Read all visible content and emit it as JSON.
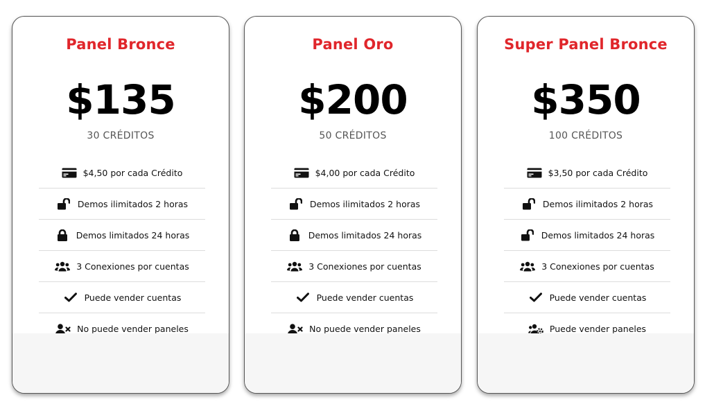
{
  "colors": {
    "title": "#e0262b",
    "price": "#000000",
    "footer": "#f6f6f6"
  },
  "plans": [
    {
      "title": "Panel Bronce",
      "price": "$135",
      "credits": "30 CRÉDITOS",
      "features": [
        {
          "icon": "credit-card-icon",
          "text": "$4,50 por cada Crédito"
        },
        {
          "icon": "unlock-icon",
          "text": "Demos ilimitados 2 horas"
        },
        {
          "icon": "lock-icon",
          "text": "Demos limitados 24 horas"
        },
        {
          "icon": "users-icon",
          "text": "3 Conexiones por cuentas"
        },
        {
          "icon": "check-icon",
          "text": "Puede vender cuentas"
        },
        {
          "icon": "user-x-icon",
          "text": "No puede vender paneles"
        }
      ]
    },
    {
      "title": "Panel Oro",
      "price": "$200",
      "credits": "50 CRÉDITOS",
      "features": [
        {
          "icon": "credit-card-icon",
          "text": "$4,00 por cada Crédito"
        },
        {
          "icon": "unlock-icon",
          "text": "Demos ilimitados 2 horas"
        },
        {
          "icon": "lock-icon",
          "text": "Demos limitados 24 horas"
        },
        {
          "icon": "users-icon",
          "text": "3 Conexiones por cuentas"
        },
        {
          "icon": "check-icon",
          "text": "Puede vender cuentas"
        },
        {
          "icon": "user-x-icon",
          "text": "No puede vender paneles"
        }
      ]
    },
    {
      "title": "Super Panel Bronce",
      "price": "$350",
      "credits": "100 CRÉDITOS",
      "features": [
        {
          "icon": "credit-card-icon",
          "text": "$3,50 por cada Crédito"
        },
        {
          "icon": "unlock-icon",
          "text": "Demos ilimitados 2 horas"
        },
        {
          "icon": "unlock-icon",
          "text": "Demos limitados 24 horas"
        },
        {
          "icon": "users-icon",
          "text": "3 Conexiones por cuentas"
        },
        {
          "icon": "check-icon",
          "text": "Puede vender cuentas"
        },
        {
          "icon": "users-cog-icon",
          "text": "Puede vender paneles"
        }
      ]
    }
  ]
}
